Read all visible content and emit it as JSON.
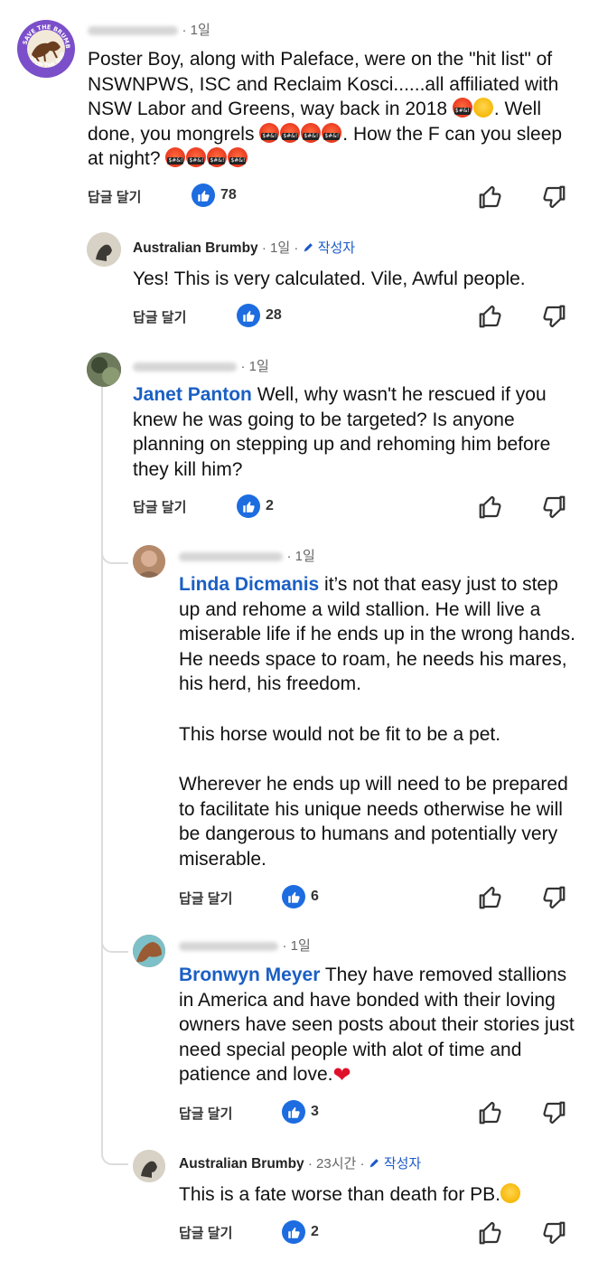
{
  "comments": [
    {
      "time": "1일",
      "text": "Poster Boy, along with Paleface, were on the \"hit list\" of NSWNPWS, ISC and Reclaim Kosci......all affiliated with NSW Labor and Greens, way back in 2018",
      "text2": ". Well done, you mongrels",
      "text3": ". How the F can you sleep at night?",
      "reply_label": "답글 달기",
      "likes": "78"
    },
    {
      "name": "Australian Brumby",
      "time": "1일",
      "author_badge": "작성자",
      "text": "Yes! This is very calculated. Vile, Awful people.",
      "reply_label": "답글 달기",
      "likes": "28"
    },
    {
      "time": "1일",
      "mention": "Janet Panton",
      "text": " Well, why wasn't he rescued if you knew he was going to be targeted? Is anyone planning on stepping up and rehoming him before they kill him?",
      "reply_label": "답글 달기",
      "likes": "2"
    },
    {
      "time": "1일",
      "mention": "Linda Dicmanis",
      "text": " it’s not that easy just to step up and rehome a wild stallion. He will live a miserable life if he ends up in the wrong hands. He needs space to roam, he needs his mares, his herd, his freedom.",
      "text2": "This horse would not be fit to be a pet.",
      "text3": "Wherever he ends up will need to be prepared to facilitate his unique needs otherwise he will be dangerous to humans and potentially very miserable.",
      "reply_label": "답글 달기",
      "likes": "6"
    },
    {
      "time": "1일",
      "mention": "Bronwyn Meyer",
      "text": " They have removed stallions in America and have bonded with their loving owners have seen posts about their stories just need special people with alot of time and patience and love.",
      "reply_label": "답글 달기",
      "likes": "3"
    },
    {
      "name": "Australian Brumby",
      "time": "23시간",
      "author_badge": "작성자",
      "text": "This is a fate worse than death for PB.",
      "reply_label": "답글 달기",
      "likes": "2"
    }
  ],
  "avatar_logo_text": [
    "SAVE THE BRUMBIES",
    "STOP THE SHOOTING"
  ],
  "icons": {
    "like": "thumbs-up-icon",
    "dislike": "thumbs-down-icon",
    "author": "pen-icon"
  },
  "colors": {
    "like_badge": "#1d6ce0",
    "mention": "#1a5fc4",
    "author_badge": "#1a58c9"
  }
}
